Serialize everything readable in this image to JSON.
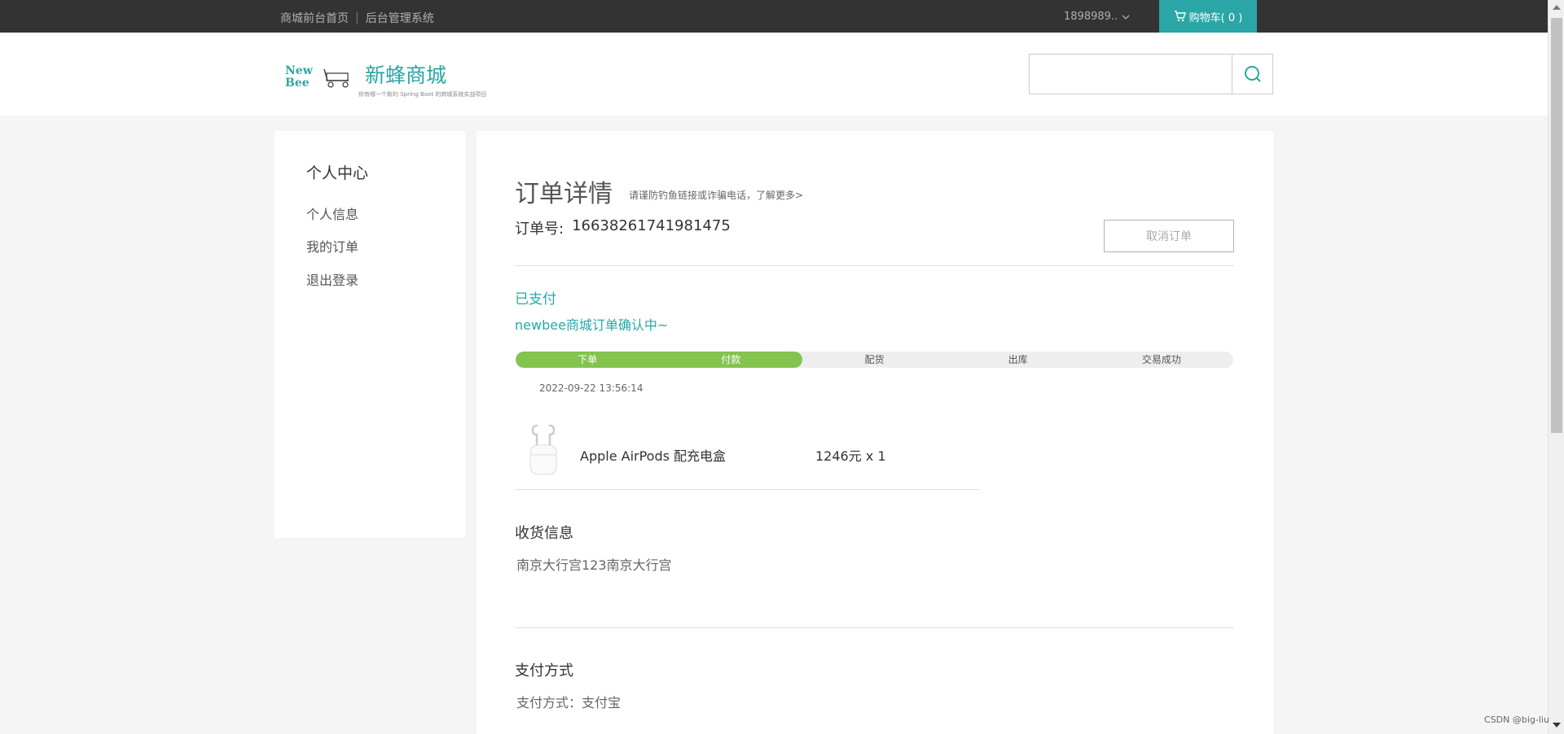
{
  "topbar": {
    "link_home": "商城前台首页",
    "link_admin": "后台管理系统",
    "username": "1898989..",
    "cart_label": "购物车( 0 )"
  },
  "header": {
    "brand_name": "新蜂商城",
    "logo_text_top": "New",
    "logo_text_bottom": "Bee",
    "slogan": "你有哪一个新的 Spring Boot 的商城系统实战项目"
  },
  "sidebar": {
    "title": "个人中心",
    "items": [
      {
        "label": "个人信息"
      },
      {
        "label": "我的订单"
      },
      {
        "label": "退出登录"
      }
    ]
  },
  "order": {
    "title": "订单详情",
    "tip": "请谨防钓鱼链接或诈骗电话，了解更多>",
    "order_no_label": "订单号:",
    "order_no": "16638261741981475",
    "cancel_label": "取消订单",
    "status": "已支付",
    "status_desc": "newbee商城订单确认中~",
    "steps": [
      "下单",
      "付款",
      "配货",
      "出库",
      "交易成功"
    ],
    "progress_completed_steps": 2,
    "step_time": "2022-09-22 13:56:14",
    "goods": {
      "name": "Apple AirPods 配充电盒",
      "price": "1246元 x 1",
      "icon": "airpods-image"
    },
    "address_title": "收货信息",
    "address": "南京大行宫123南京大行宫",
    "pay_title": "支付方式",
    "pay_method": "支付方式：支付宝"
  },
  "watermark": "CSDN @big-liu",
  "colors": {
    "accent": "#2aa6a6",
    "progress_done": "#83c44e",
    "topbar_bg": "#333333"
  }
}
